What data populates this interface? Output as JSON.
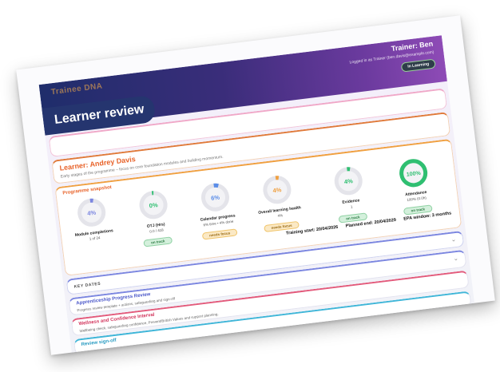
{
  "header": {
    "org_text": "Trainee DNA",
    "trainer": "Trainer: Ben",
    "logged_in": "Logged in as Trainer (ben.davis@example.com)",
    "pill": "In Learning",
    "page_title": "Learner review"
  },
  "learner": {
    "name": "Learner: Andrey Davis",
    "subtitle": "Early stages of the programme – focus on core foundation modules and building momentum."
  },
  "snapshot": {
    "heading": "Programme snapshot",
    "gauges": [
      {
        "value": "4%",
        "fraction": 0.04,
        "label": "Module completions",
        "sub": "1 of 24",
        "badge": "",
        "badge_type": "",
        "color": "#7b86e0"
      },
      {
        "value": "0%",
        "fraction": 0.0,
        "label": "OTJ (Hrs)",
        "sub": "0.0 / 418",
        "badge": "on track",
        "badge_type": "ok",
        "color": "#2fbf71"
      },
      {
        "value": "6%",
        "fraction": 0.06,
        "label": "Calendar progress",
        "sub": "6% time • 4% done",
        "badge": "needs focus",
        "badge_type": "focus",
        "color": "#5b8de8"
      },
      {
        "value": "4%",
        "fraction": 0.04,
        "label": "Overall learning health",
        "sub": "4%",
        "badge": "needs focus",
        "badge_type": "focus",
        "color": "#f0a040"
      },
      {
        "value": "4%",
        "fraction": 0.04,
        "label": "Evidence",
        "sub": "1",
        "badge": "on track",
        "badge_type": "ok",
        "color": "#2fbf71"
      },
      {
        "value": "100%",
        "fraction": 1.0,
        "label": "Attendance",
        "sub": "100% (0.0h)",
        "badge": "on track",
        "badge_type": "ok",
        "color": "#2fbf71"
      }
    ],
    "training_start": "Training start: 20/04/2026",
    "planned_end": "Planned end: 20/04/2029",
    "epa_window": "EPA window: 3 months"
  },
  "sections": {
    "key_dates": "KEY DATES",
    "apr_title": "Apprenticeship Progress Review",
    "apr_desc": "Progress review template + actions, safeguarding and sign-off",
    "wci_title": "Wellness and Confidence Interval",
    "wci_desc": "Wellbeing check, safeguarding confidence, Prevent/British Values and support planning.",
    "rso_title": "Review sign-off"
  },
  "colors": {
    "header_start": "#1f2d6b",
    "header_end": "#8e4bb6",
    "accent_orange": "#e8632a",
    "ok_green": "#2fbf71"
  }
}
